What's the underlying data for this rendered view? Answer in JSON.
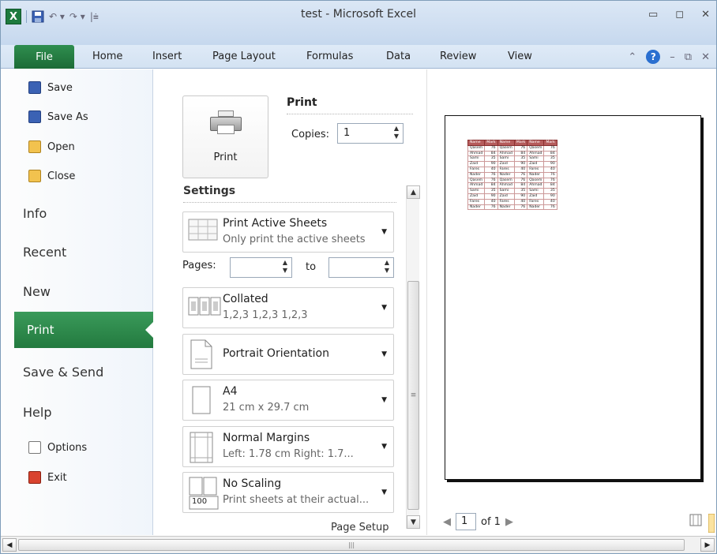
{
  "window": {
    "title": "test - Microsoft Excel",
    "app_icon": "X",
    "controls": [
      "minimize-icon",
      "maximize-icon",
      "close-icon"
    ]
  },
  "quick_access": [
    "save-icon",
    "undo-icon",
    "redo-icon",
    "customize-icon"
  ],
  "ribbon": {
    "file_tab": "File",
    "tabs": [
      "Home",
      "Insert",
      "Page Layout",
      "Formulas",
      "Data",
      "Review",
      "View"
    ],
    "right_icons": [
      "minimize-ribbon-icon",
      "help-icon",
      "doc-minimize-icon",
      "doc-restore-icon",
      "doc-close-icon"
    ],
    "help_glyph": "?"
  },
  "backstage": {
    "small_items": [
      {
        "label": "Save",
        "icon": "save-icon"
      },
      {
        "label": "Save As",
        "icon": "save-as-icon"
      },
      {
        "label": "Open",
        "icon": "open-folder-icon"
      },
      {
        "label": "Close",
        "icon": "close-folder-icon"
      }
    ],
    "big_items": [
      "Info",
      "Recent",
      "New",
      "Print",
      "Save & Send",
      "Help"
    ],
    "selected": "Print",
    "bottom_items": [
      {
        "label": "Options",
        "icon": "options-icon"
      },
      {
        "label": "Exit",
        "icon": "exit-icon"
      }
    ]
  },
  "print": {
    "button_label": "Print",
    "heading": "Print",
    "copies_label": "Copies:",
    "copies_value": "1",
    "settings_heading": "Settings",
    "options": [
      {
        "title": "Print Active Sheets",
        "subtitle": "Only print the active sheets"
      },
      {
        "title": "Collated",
        "subtitle": "1,2,3   1,2,3   1,2,3"
      },
      {
        "title": "Portrait Orientation",
        "subtitle": ""
      },
      {
        "title": "A4",
        "subtitle": "21 cm x 29.7 cm"
      },
      {
        "title": "Normal Margins",
        "subtitle": "Left:  1.78 cm    Right:  1.7..."
      },
      {
        "title": "No Scaling",
        "subtitle": "Print sheets at their actual..."
      }
    ],
    "scaling_badge": "100",
    "pages_label": "Pages:",
    "pages_to": "to",
    "page_setup_link": "Page Setup"
  },
  "preview": {
    "table_headers": [
      "Name",
      "Mark",
      "Name",
      "Mark",
      "Name",
      "Mark"
    ],
    "rows": [
      [
        "Qasem",
        "76"
      ],
      [
        "Ahmad",
        "84"
      ],
      [
        "Sami",
        "35"
      ],
      [
        "Zaid",
        "90"
      ],
      [
        "Fares",
        "40"
      ],
      [
        "Nader",
        "76"
      ],
      [
        "Qasem",
        "76"
      ],
      [
        "Ahmad",
        "84"
      ],
      [
        "Sami",
        "35"
      ],
      [
        "Zaid",
        "90"
      ],
      [
        "Fares",
        "40"
      ],
      [
        "Nader",
        "76"
      ]
    ],
    "current_page": "1",
    "of_pages": "of 1"
  }
}
